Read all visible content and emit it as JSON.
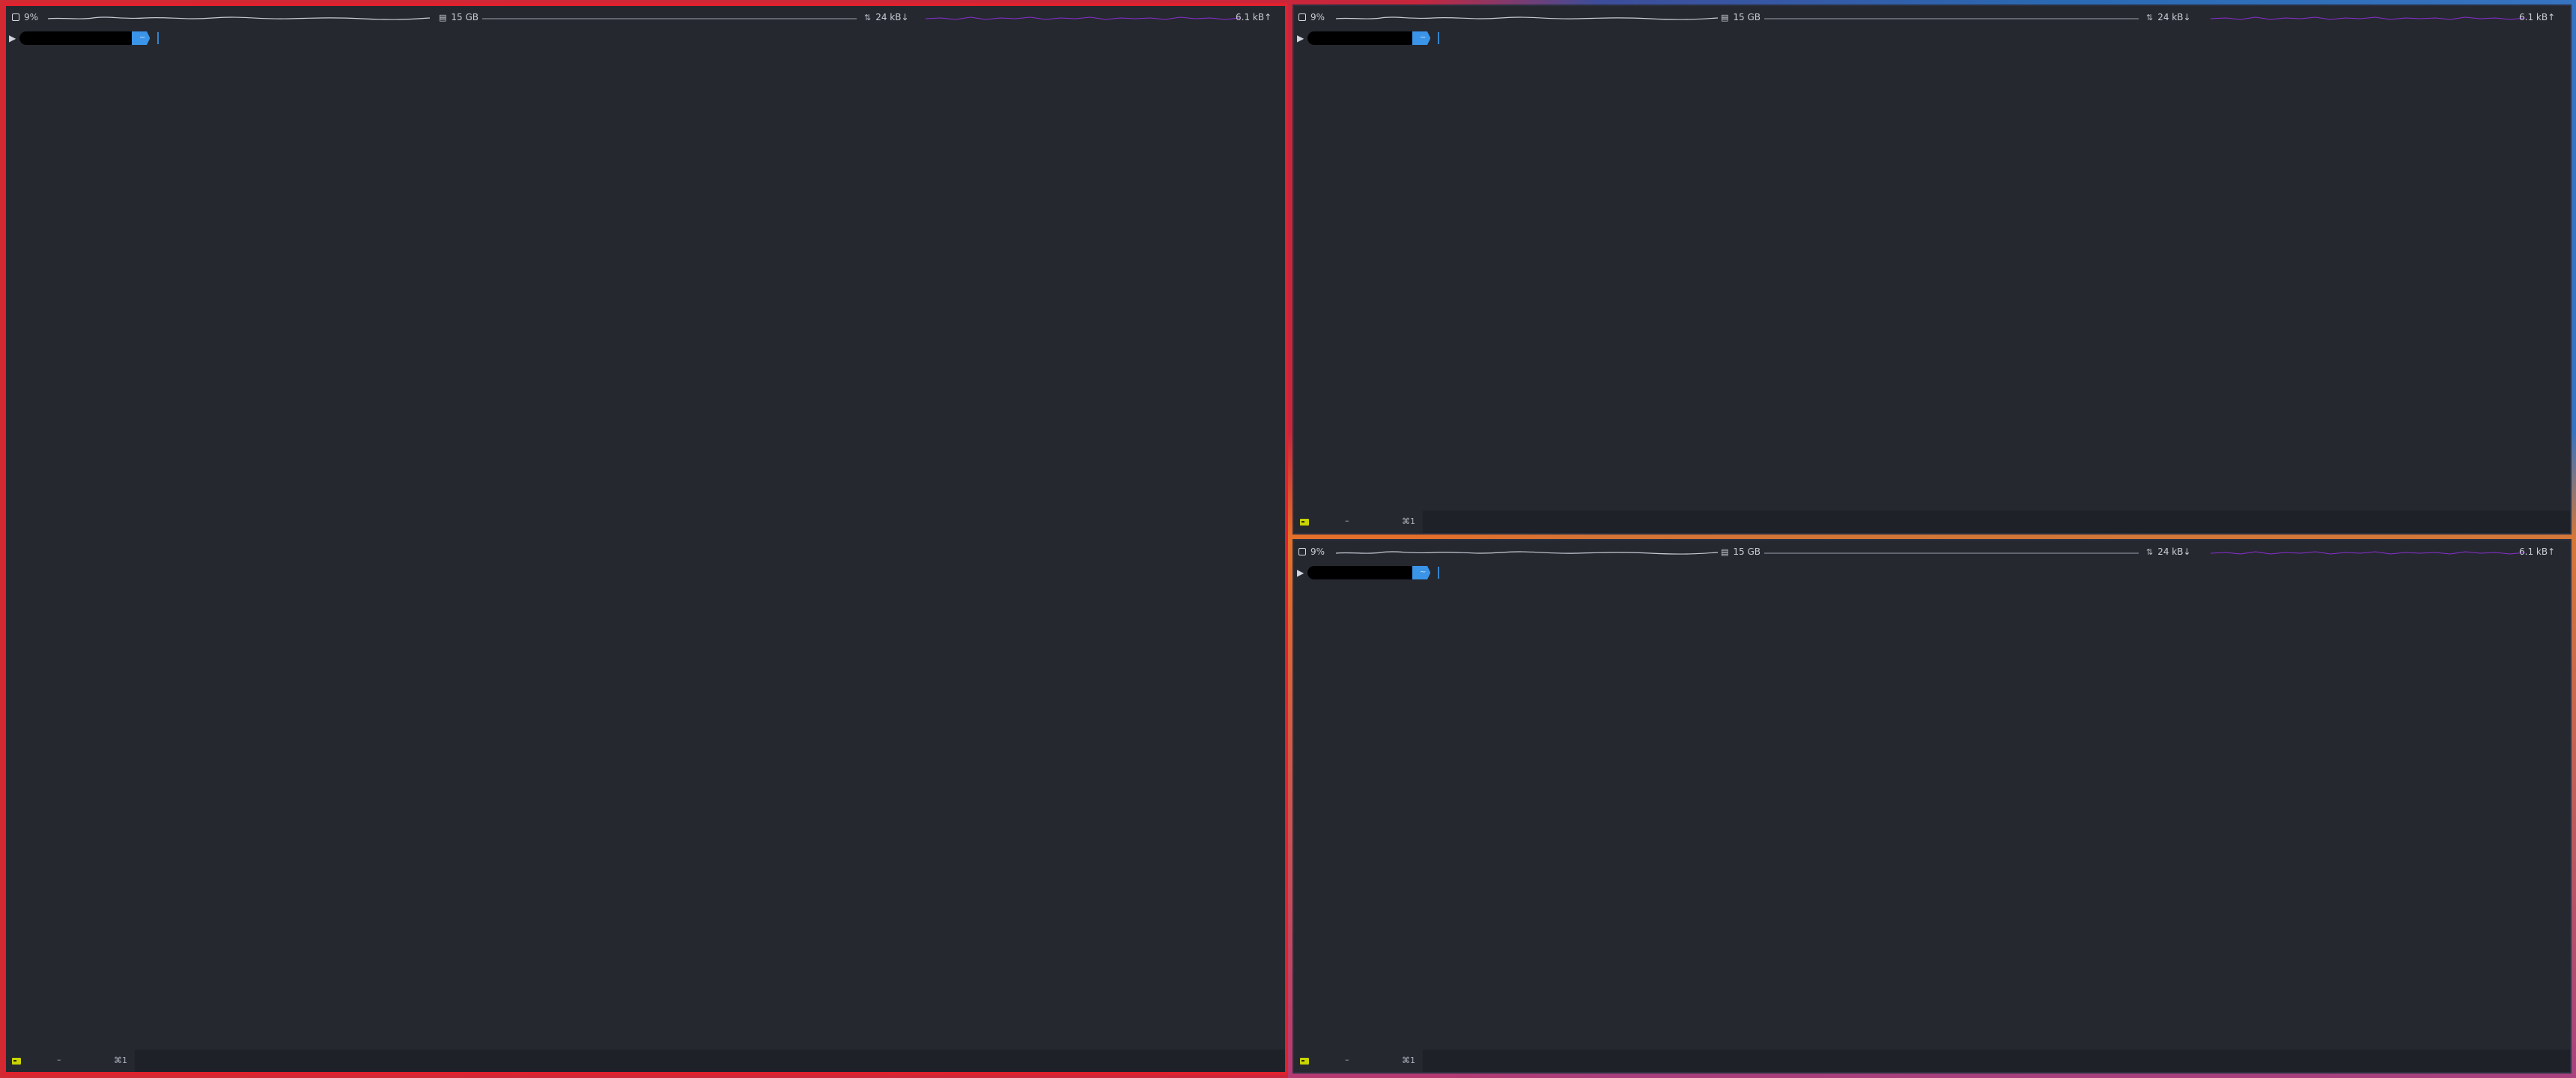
{
  "panes": [
    {
      "id": "left",
      "status": {
        "cpu": "9%",
        "memory": "15 GB",
        "download": "24 kB↓",
        "upload": "6.1 kB↑"
      },
      "prompt": {
        "user": "",
        "directory": "~"
      },
      "footer": {
        "dash": "–",
        "shortcut": "⌘1"
      }
    },
    {
      "id": "right-top",
      "status": {
        "cpu": "9%",
        "memory": "15 GB",
        "download": "24 kB↓",
        "upload": "6.1 kB↑"
      },
      "prompt": {
        "user": "",
        "directory": "~"
      },
      "footer": {
        "dash": "–",
        "shortcut": "⌘1"
      }
    },
    {
      "id": "right-bottom",
      "status": {
        "cpu": "9%",
        "memory": "15 GB",
        "download": "24 kB↓",
        "upload": "6.1 kB↑"
      },
      "prompt": {
        "user": "",
        "directory": "~"
      },
      "footer": {
        "dash": "–",
        "shortcut": "⌘1"
      }
    }
  ],
  "icons": {
    "cpu": "cpu-icon",
    "memory": "memory-icon",
    "network": "network-icon",
    "terminal": "terminal-icon",
    "prompt": "prompt-arrow-icon"
  },
  "colors": {
    "pane_background": "#262830",
    "active_border": "#e0222e",
    "prompt_directory": "#3a94e8",
    "sparkline_cpu": "#c8ccd4",
    "sparkline_upload": "#8a2fd0",
    "terminal_icon": "#c9d400"
  }
}
